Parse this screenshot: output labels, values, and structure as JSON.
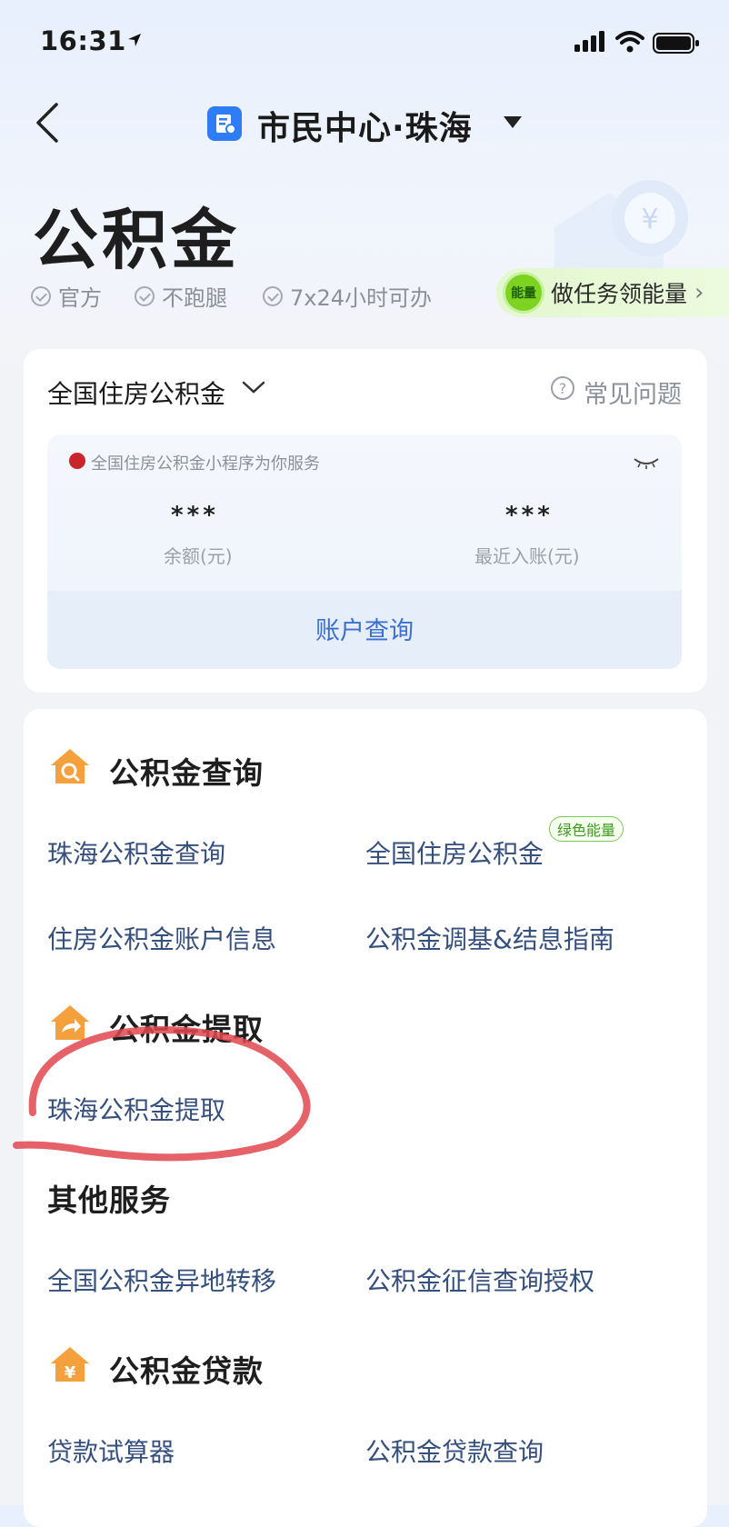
{
  "status_bar": {
    "time": "16:31"
  },
  "nav": {
    "title": "市民中心·珠海"
  },
  "hero": {
    "title": "公积金",
    "tags": [
      "官方",
      "不跑腿",
      "7x24小时可办"
    ],
    "energy_badge": "能量",
    "energy_task": "做任务领能量"
  },
  "account_card": {
    "selector": "全国住房公积金",
    "faq": "常见问题",
    "service_note": "全国住房公积金小程序为你服务",
    "balance_value": "***",
    "balance_label": "余额(元)",
    "recent_value": "***",
    "recent_label": "最近入账(元)",
    "query_button": "账户查询"
  },
  "sections": {
    "query": {
      "title": "公积金查询",
      "items": [
        "珠海公积金查询",
        "全国住房公积金",
        "住房公积金账户信息",
        "公积金调基&结息指南"
      ],
      "badge": "绿色能量"
    },
    "withdraw": {
      "title": "公积金提取",
      "items": [
        "珠海公积金提取"
      ]
    },
    "other": {
      "title": "其他服务",
      "items": [
        "全国公积金异地转移",
        "公积金征信查询授权"
      ]
    },
    "loan": {
      "title": "公积金贷款",
      "items": [
        "贷款试算器",
        "公积金贷款查询"
      ]
    }
  },
  "colors": {
    "accent_blue": "#2e7cf6",
    "link": "#36507e",
    "energy_green": "#7ed321",
    "annotation_red": "#e0474f",
    "section_icon_orange": "#f4a03c"
  }
}
